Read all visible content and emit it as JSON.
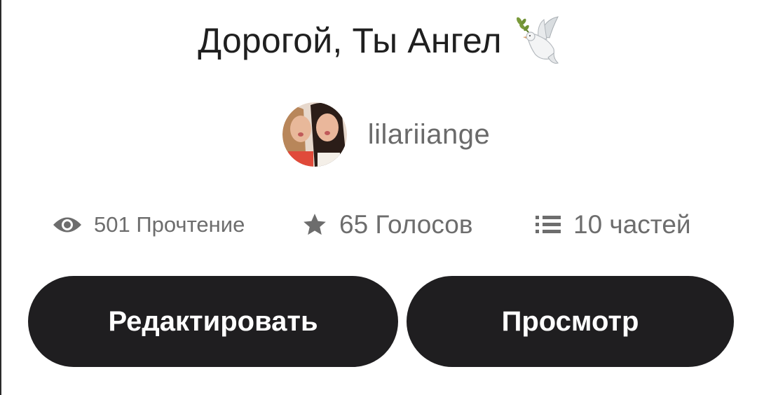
{
  "story": {
    "title": "Дорогой, Ты Ангел",
    "title_icon": "dove-icon"
  },
  "author": {
    "username": "lilariiange",
    "avatar_icon": "avatar"
  },
  "stats": {
    "reads": {
      "icon": "eye-icon",
      "label": "501 Прочтение"
    },
    "votes": {
      "icon": "star-icon",
      "label": "65 Голосов"
    },
    "parts": {
      "icon": "list-icon",
      "label": "10 частей"
    }
  },
  "actions": {
    "edit_label": "Редактировать",
    "view_label": "Просмотр"
  },
  "colors": {
    "button_bg": "#1f1e20",
    "button_text": "#ffffff",
    "title_text": "#1f1f1f",
    "meta_text": "#6d6d6d"
  }
}
